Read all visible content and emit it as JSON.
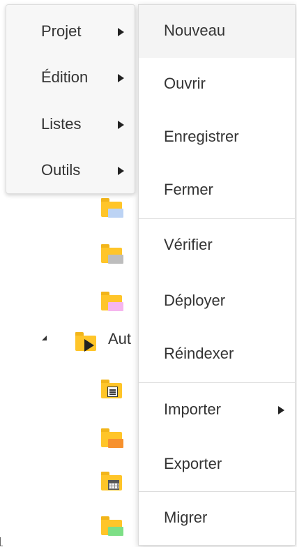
{
  "colors": {
    "menu_background": "#f7f7f7",
    "submenu_background": "#ffffff",
    "hover_background": "#f4f4f4",
    "text": "#333333",
    "folder": "#ffc529",
    "badge_blue": "#bcd3f4",
    "badge_gray": "#bdbdbd",
    "badge_pink": "#f6b5ee",
    "badge_orange": "#f7912e",
    "badge_green": "#7ddf86"
  },
  "main_menu": {
    "items": [
      {
        "label": "Projet",
        "icon": "caret-right-icon",
        "active": true
      },
      {
        "label": "Édition",
        "icon": "caret-right-icon"
      },
      {
        "label": "Listes",
        "icon": "caret-right-icon"
      },
      {
        "label": "Outils",
        "icon": "caret-right-icon"
      }
    ]
  },
  "submenu": {
    "parent": "Projet",
    "items": [
      {
        "label": "Nouveau",
        "highlighted": true
      },
      {
        "label": "Ouvrir"
      },
      {
        "label": "Enregistrer"
      },
      {
        "label": "Fermer"
      },
      {
        "label": "Vérifier"
      },
      {
        "label": "Déployer"
      },
      {
        "label": "Réindexer"
      },
      {
        "label": "Importer",
        "icon": "caret-right-icon"
      },
      {
        "label": "Exporter"
      },
      {
        "label": "Migrer"
      }
    ]
  },
  "tree": {
    "visible_label": "Aut",
    "icons": [
      "folder-blue-icon",
      "folder-gray-icon",
      "folder-pink-icon",
      "folder-play-icon",
      "folder-document-icon",
      "folder-orange-icon",
      "folder-calendar-icon",
      "folder-green-icon"
    ]
  }
}
